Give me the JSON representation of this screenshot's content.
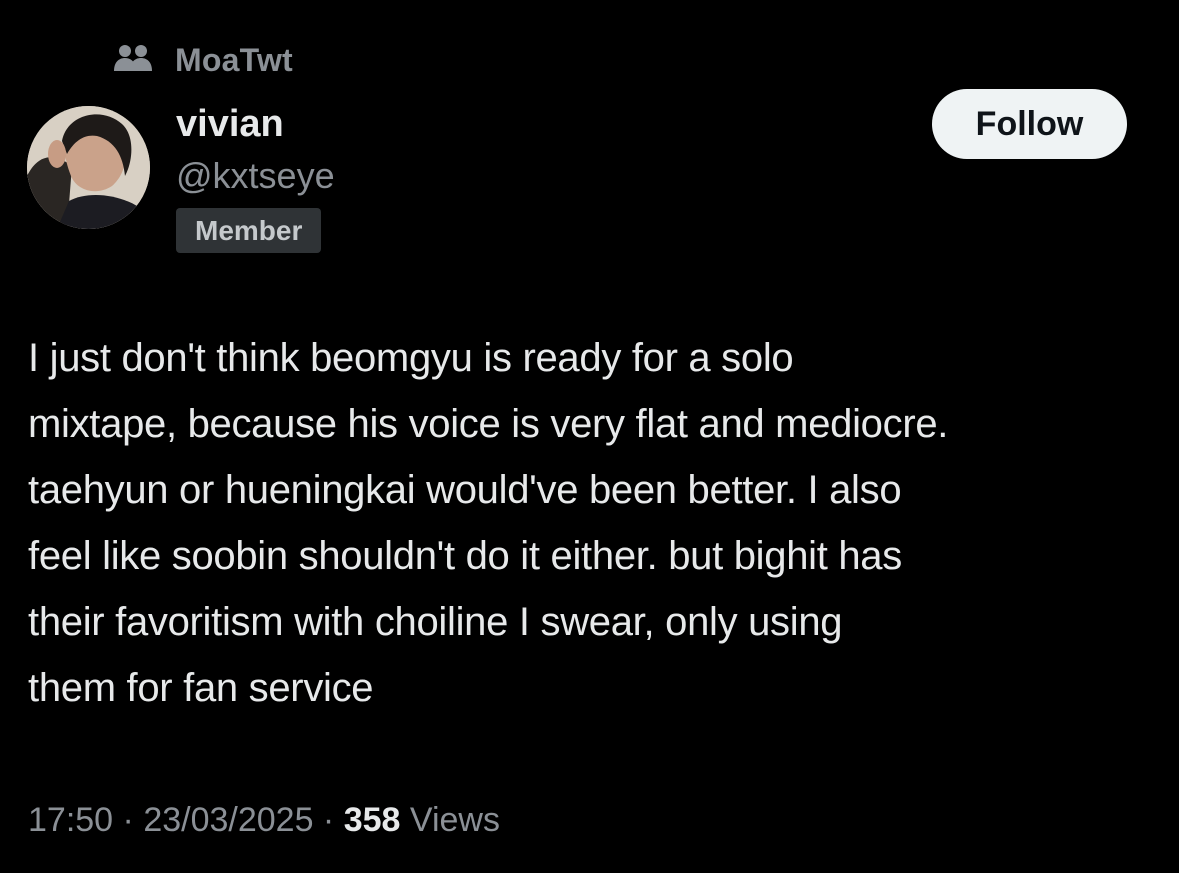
{
  "community": {
    "name": "MoaTwt",
    "icon": "community-people-icon"
  },
  "author": {
    "display_name": "vivian",
    "handle": "@kxtseye",
    "badge": "Member",
    "avatar_icon": "profile-photo"
  },
  "follow_button": {
    "label": "Follow"
  },
  "tweet": {
    "text": "I just don't think beomgyu is ready for a solo\nmixtape, because his voice is very flat and mediocre.\ntaehyun or hueningkai would've been better. I also\nfeel like soobin shouldn't do it either. but bighit has\ntheir favoritism with choiline I swear, only using\nthem for fan service"
  },
  "meta": {
    "time": "17:50",
    "separator": " · ",
    "date": "23/03/2025",
    "views_count": "358",
    "views_label": "Views"
  },
  "colors": {
    "background": "#000000",
    "primary_text": "#e7e9ea",
    "secondary_text": "#8b9096",
    "badge_background": "#2f3336",
    "follow_background": "#eff3f4",
    "follow_text": "#0f1419"
  }
}
